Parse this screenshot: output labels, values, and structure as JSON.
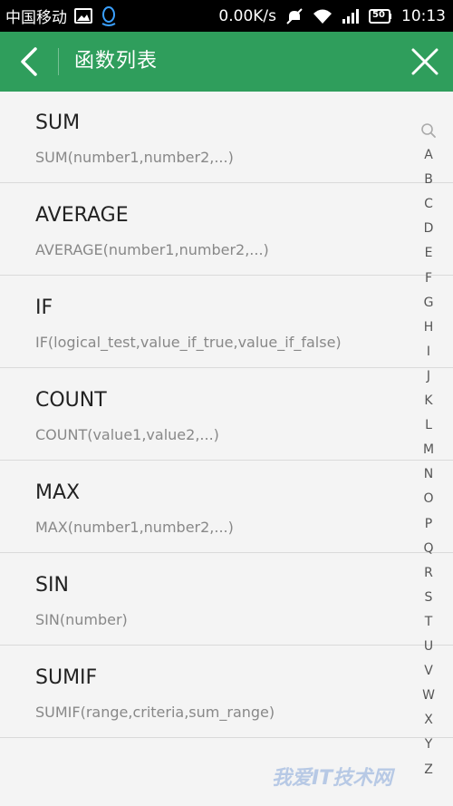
{
  "status_bar": {
    "carrier": "中国移动",
    "speed": "0.00K/s",
    "battery": "50",
    "time": "10:13",
    "icons": [
      "image-icon",
      "qq-icon",
      "mute-icon",
      "wifi-icon",
      "signal-icon",
      "battery-icon"
    ]
  },
  "app_bar": {
    "title": "函数列表",
    "back_icon": "chevron-left-icon",
    "close_icon": "close-icon",
    "color": "#2f9e5c"
  },
  "functions": [
    {
      "name": "SUM",
      "signature": "SUM(number1,number2,...)"
    },
    {
      "name": "AVERAGE",
      "signature": "AVERAGE(number1,number2,...)"
    },
    {
      "name": "IF",
      "signature": "IF(logical_test,value_if_true,value_if_false)"
    },
    {
      "name": "COUNT",
      "signature": "COUNT(value1,value2,...)"
    },
    {
      "name": "MAX",
      "signature": "MAX(number1,number2,...)"
    },
    {
      "name": "SIN",
      "signature": "SIN(number)"
    },
    {
      "name": "SUMIF",
      "signature": "SUMIF(range,criteria,sum_range)"
    }
  ],
  "index_letters": [
    "A",
    "B",
    "C",
    "D",
    "E",
    "F",
    "G",
    "H",
    "I",
    "J",
    "K",
    "L",
    "M",
    "N",
    "O",
    "P",
    "Q",
    "R",
    "S",
    "T",
    "U",
    "V",
    "W",
    "X",
    "Y",
    "Z"
  ],
  "watermark": "我爱IT技术网"
}
